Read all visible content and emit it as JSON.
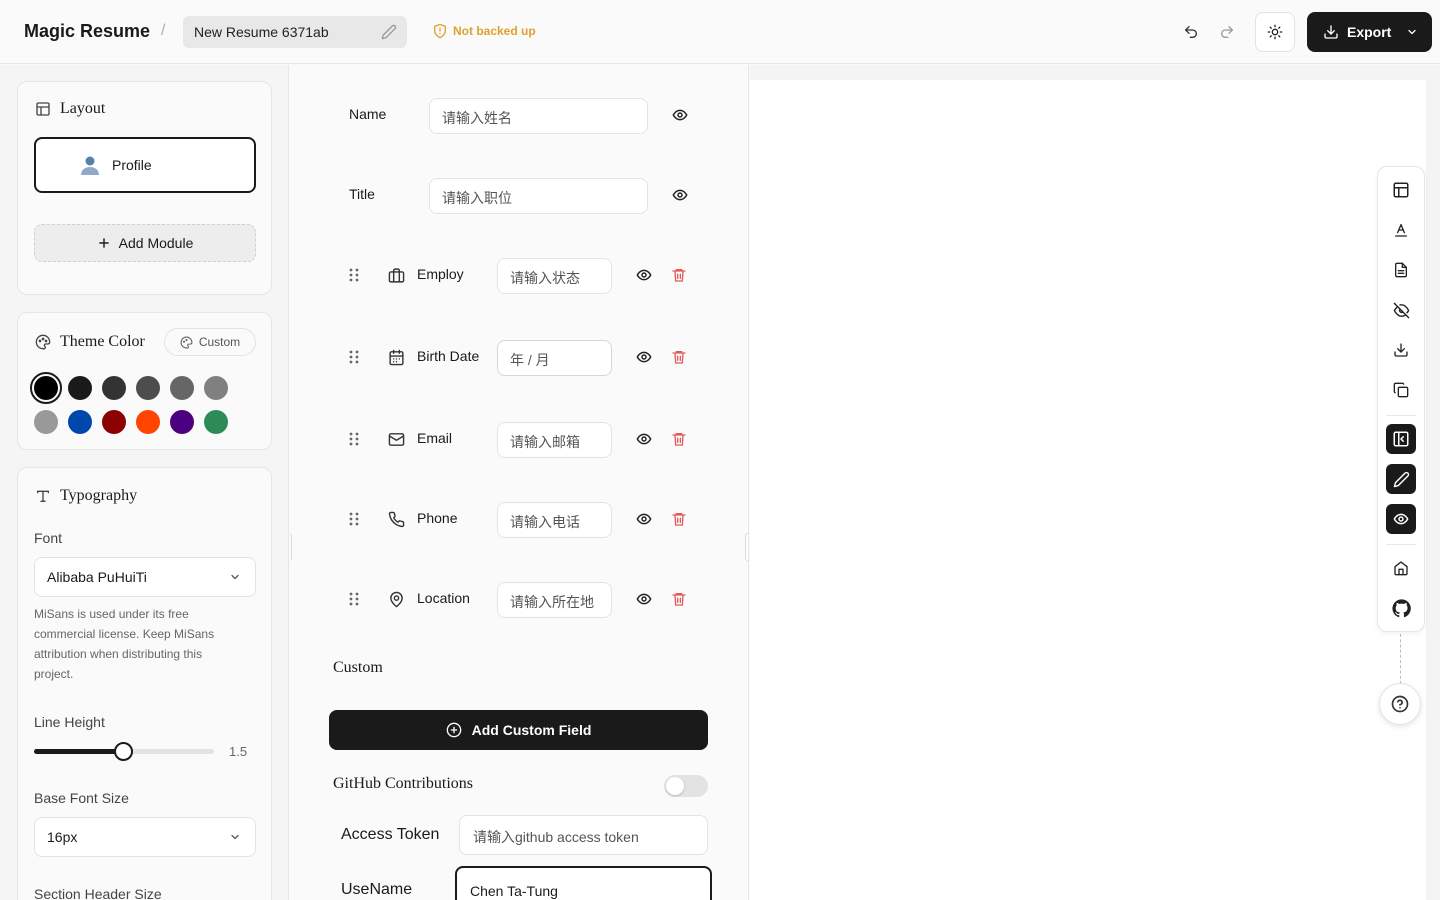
{
  "header": {
    "brand": "Magic Resume",
    "separator": "/",
    "resume_name": "New Resume 6371ab",
    "backup_status": "Not backed up",
    "export_label": "Export"
  },
  "sidebar": {
    "layout": {
      "title": "Layout",
      "profile_label": "Profile",
      "add_module_label": "Add Module"
    },
    "theme": {
      "title": "Theme Color",
      "custom_label": "Custom",
      "swatches": [
        "#000000",
        "#1a1a1a",
        "#333333",
        "#4d4d4d",
        "#666666",
        "#808080",
        "#999999",
        "#0047ab",
        "#8b0000",
        "#ff4500",
        "#4b0082",
        "#2e8b57"
      ],
      "selected_color": "#000000"
    },
    "typography": {
      "title": "Typography",
      "font_label": "Font",
      "font_value": "Alibaba PuHuiTi",
      "font_note": "MiSans is used under its free commercial license. Keep MiSans attribution when distributing this project.",
      "line_height_label": "Line Height",
      "line_height_value": "1.5",
      "line_height_fraction": 0.5,
      "base_font_label": "Base Font Size",
      "base_font_value": "16px",
      "section_header_label": "Section Header Size"
    }
  },
  "editor": {
    "name": {
      "label": "Name",
      "placeholder": "请输入姓名"
    },
    "title": {
      "label": "Title",
      "placeholder": "请输入职位"
    },
    "fields": [
      {
        "label": "Employ",
        "placeholder": "请输入状态",
        "icon": "briefcase-icon"
      },
      {
        "label": "Birth Date",
        "placeholder": "年 / 月",
        "icon": "calendar-icon"
      },
      {
        "label": "Email",
        "placeholder": "请输入邮箱",
        "icon": "mail-icon"
      },
      {
        "label": "Phone",
        "placeholder": "请输入电话",
        "icon": "phone-icon"
      },
      {
        "label": "Location",
        "placeholder": "请输入所在地",
        "icon": "map-pin-icon"
      }
    ],
    "custom_section_title": "Custom",
    "add_custom_label": "Add Custom Field",
    "github_title": "GitHub Contributions",
    "access_token_label": "Access Token",
    "access_token_placeholder": "请输入github access token",
    "username_label": "UseName",
    "username_value": "Chen Ta-Tung"
  },
  "colors": {
    "accent": "#1a1a1a",
    "warning": "#e0a030",
    "danger": "#e05a5a"
  }
}
